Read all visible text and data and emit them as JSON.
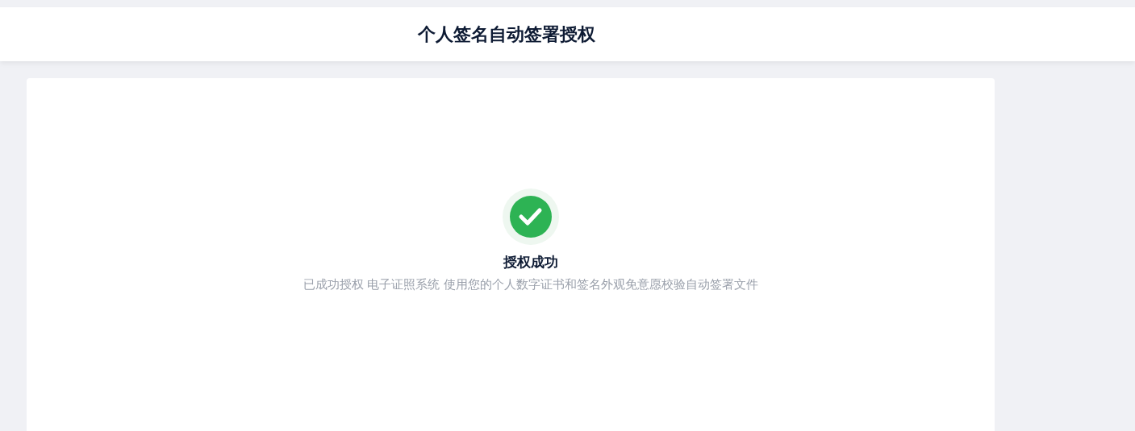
{
  "header": {
    "title": "个人签名自动签署授权"
  },
  "result": {
    "kind": "success",
    "title": "授权成功",
    "message": "已成功授权 电子证照系统 使用您的个人数字证书和签名外观免意愿校验自动签署文件"
  }
}
